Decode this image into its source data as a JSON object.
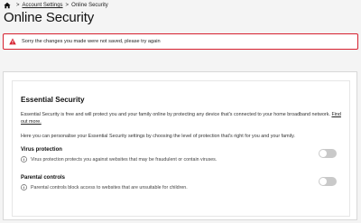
{
  "breadcrumb": {
    "home_icon": "home-icon",
    "items": [
      {
        "label": "Account Settings"
      },
      {
        "label": "Online Security"
      }
    ],
    "separator": ">"
  },
  "page": {
    "title": "Online Security"
  },
  "alert": {
    "icon": "warning-icon",
    "color": "#d6202f",
    "message": "Sorry the changes you made were not saved, please try again"
  },
  "essential_security": {
    "title": "Essential Security",
    "intro": "Essential Security is free and will protect you and your family online by protecting any device that's connected to your home broadband network.",
    "find_out_more": "Find out more.",
    "personalise": "Here you can personalise your Essential Security settings by choosing the level of protection that's right for you and your family.",
    "settings": [
      {
        "label": "Virus protection",
        "description": "Virus protection protects you against websites that may be fraudulent or contain viruses.",
        "enabled": false
      },
      {
        "label": "Parental controls",
        "description": "Parental controls block access to websites that are unsuitable for children.",
        "enabled": false
      }
    ]
  }
}
